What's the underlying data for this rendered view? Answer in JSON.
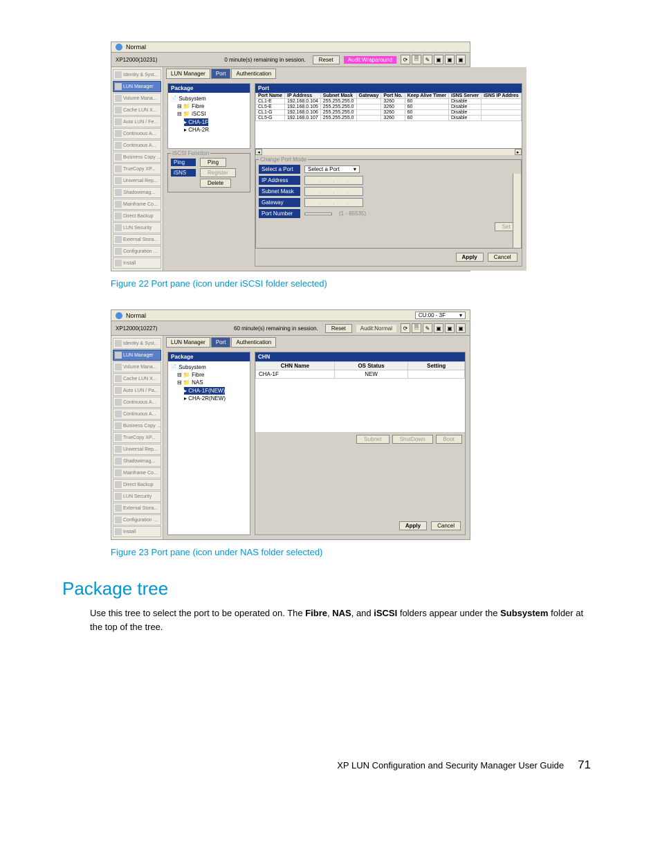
{
  "fig22": {
    "caption": "Figure 22 Port pane (icon under iSCSI folder selected)",
    "status": "Normal",
    "device": "XP12000(10231)",
    "session": "0 minute(s) remaining in session.",
    "reset": "Reset",
    "audit": "Audit:Wraparound",
    "tabs": {
      "a": "LUN Manager",
      "b": "Port",
      "c": "Authentication"
    },
    "sidebar": [
      "Identity & Syst...",
      "LUN Manager",
      "Volume Mana...",
      "Cache LUN X...",
      "Auto LUN / Fe...",
      "Continuous A...",
      "Continuous A...",
      "Business Copy ...",
      "TrueCopy XP...",
      "Universal Rep...",
      "Shadowimag...",
      "Mainframe Co...",
      "Direct Backup",
      "LUN Security",
      "External Stora...",
      "Configuration ...",
      "Install"
    ],
    "active_sidebar": 1,
    "pkg_hd": "Package",
    "tree": {
      "root": "Subsystem",
      "fibre": "Fibre",
      "iscsi": "iSCSI",
      "cha1f": "CHA-1F",
      "cha2r": "CHA-2R"
    },
    "iscsi_func": {
      "title": "iSCSI Function",
      "ping": "Ping",
      "ping_btn": "Ping",
      "isns": "iSNS",
      "register": "Register",
      "delete": "Delete"
    },
    "port_hd": "Port",
    "table_headers": [
      "Port Name",
      "IP Address",
      "Subnet Mask",
      "Gateway",
      "Port No.",
      "Keep Alive Timer",
      "iSNS Server",
      "iSNS IP Addres"
    ],
    "rows": [
      [
        "CL1-E",
        "192.168.0.104",
        "255.255.255.0",
        "",
        "3260",
        "60",
        "Disable",
        ""
      ],
      [
        "CL5-E",
        "192.168.0.105",
        "255.255.255.0",
        "",
        "3260",
        "60",
        "Disable",
        ""
      ],
      [
        "CL1-G",
        "192.168.0.106",
        "255.255.255.0",
        "",
        "3260",
        "60",
        "Disable",
        ""
      ],
      [
        "CL5-G",
        "192.168.0.107",
        "255.255.255.0",
        "",
        "3260",
        "60",
        "Disable",
        ""
      ]
    ],
    "change_port": {
      "title": "Change Port Mode",
      "select_label": "Select a Port",
      "select_val": "Select a Port",
      "ip": "IP Address",
      "subnet": "Subnet Mask",
      "gateway": "Gateway",
      "portnum": "Port Number",
      "hint": "(1 - 65535)",
      "set": "Set"
    },
    "apply": "Apply",
    "cancel": "Cancel"
  },
  "fig23": {
    "caption": "Figure 23 Port pane (icon under NAS folder selected)",
    "status": "Normal",
    "device": "XP12000(10227)",
    "session": "60 minute(s) remaining in session.",
    "cu": "CU:00 - 3F",
    "reset": "Reset",
    "audit": "Audit:Normal",
    "tabs": {
      "a": "LUN Manager",
      "b": "Port",
      "c": "Authentication"
    },
    "sidebar": [
      "Identity & Syst...",
      "LUN Manager",
      "Volume Mana...",
      "Cache LUN X...",
      "Auto LUN / Pa...",
      "Continuous A...",
      "Continuous A...",
      "Business Copy ...",
      "TrueCopy XP...",
      "Universal Rep...",
      "Shadowimag...",
      "Mainframe Co...",
      "Direct Backup",
      "LUN Security",
      "External Stora...",
      "Configuration ...",
      "Install"
    ],
    "active_sidebar": 1,
    "pkg_hd": "Package",
    "tree": {
      "root": "Subsystem",
      "fibre": "Fibre",
      "nas": "NAS",
      "cha1f": "CHA-1F(NEW)",
      "cha2r": "CHA-2R(NEW)"
    },
    "chn_hd": "CHN",
    "chn_headers": [
      "CHN Name",
      "OS Status",
      "Setting"
    ],
    "chn_row": [
      "CHA-1F",
      "NEW",
      ""
    ],
    "btns": {
      "subnet": "Subnet",
      "shutdown": "ShutDown",
      "boot": "Boot"
    },
    "apply": "Apply",
    "cancel": "Cancel"
  },
  "section": {
    "heading": "Package tree",
    "body_pre": "Use this tree to select the port to be operated on. The ",
    "b1": "Fibre",
    "sep1": ", ",
    "b2": "NAS",
    "sep2": ", and ",
    "b3": "iSCSI",
    "body_mid": " folders appear under the ",
    "b4": "Subsystem",
    "body_post": " folder at the top of the tree."
  },
  "footer": {
    "title": "XP LUN Configuration and Security Manager User Guide",
    "page": "71"
  }
}
